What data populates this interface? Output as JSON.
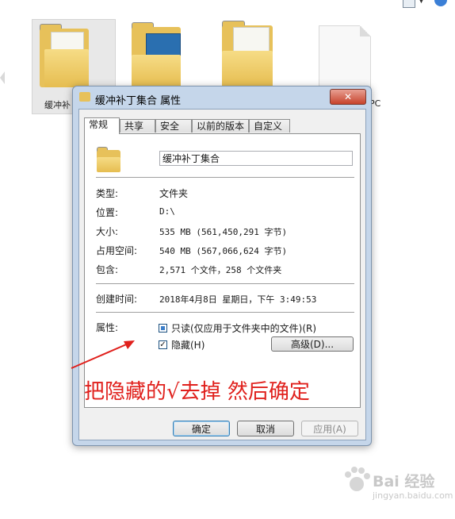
{
  "background": {
    "folder_label_1": "缓冲补",
    "label_suffix_right": "PC"
  },
  "dialog": {
    "title": "缓冲补丁集合 属性",
    "close_label": "✕",
    "tabs": [
      "常规",
      "共享",
      "安全",
      "以前的版本",
      "自定义"
    ],
    "active_tab": "常规",
    "name_value": "缓冲补丁集合",
    "fields": {
      "type_label": "类型:",
      "type_value": "文件夹",
      "location_label": "位置:",
      "location_value": "D:\\",
      "size_label": "大小:",
      "size_value": "535 MB (561,450,291 字节)",
      "disk_label": "占用空间:",
      "disk_value": "540 MB (567,066,624 字节)",
      "contains_label": "包含:",
      "contains_value": "2,571 个文件，258 个文件夹",
      "created_label": "创建时间:",
      "created_value": "2018年4月8日 星期日，下午 3:49:53",
      "attributes_label": "属性:"
    },
    "attributes": {
      "readonly_label": "只读(仅应用于文件夹中的文件)(R)",
      "readonly_state": "indeterminate",
      "hidden_label": "隐藏(H)",
      "hidden_state": "checked",
      "hidden_mark": "✓",
      "advanced_label": "高级(D)..."
    },
    "buttons": {
      "ok_label": "确定",
      "cancel_label": "取消",
      "apply_label": "应用(A)"
    }
  },
  "annotation": {
    "text": "把隐藏的√去掉 然后确定",
    "color": "#e0201c"
  },
  "watermark": {
    "text": "Bai 经验",
    "url": "jingyan.baidu.com"
  }
}
